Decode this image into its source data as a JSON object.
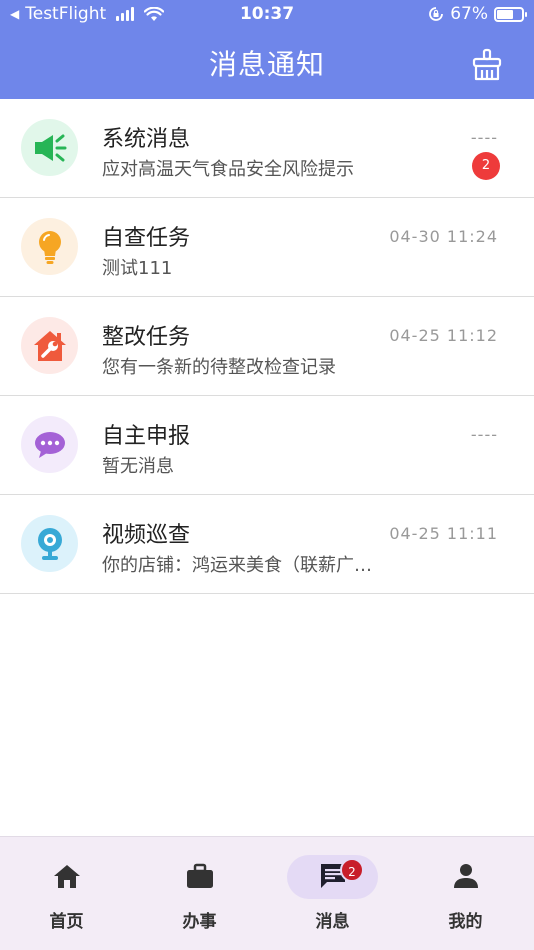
{
  "status_bar": {
    "back_app": "TestFlight",
    "time": "10:37",
    "battery": "67%"
  },
  "header": {
    "title": "消息通知",
    "clean_icon": "broom-icon"
  },
  "colors": {
    "header_bg": "#6f86ea",
    "badge": "#ee3b3b",
    "tab_badge": "#c81e2a",
    "tabbar_bg": "#f3ecf6"
  },
  "messages": [
    {
      "icon": "speaker-icon",
      "title": "系统消息",
      "subtitle": "应对高温天气食品安全风险提示",
      "time": "----",
      "badge": "2"
    },
    {
      "icon": "lightbulb-icon",
      "title": "自查任务",
      "subtitle": "测试111",
      "time": "04-30 11:24",
      "badge": ""
    },
    {
      "icon": "house-wrench-icon",
      "title": "整改任务",
      "subtitle": "您有一条新的待整改检查记录",
      "time": "04-25 11:12",
      "badge": ""
    },
    {
      "icon": "chat-bubble-icon",
      "title": "自主申报",
      "subtitle": "暂无消息",
      "time": "----",
      "badge": ""
    },
    {
      "icon": "webcam-icon",
      "title": "视频巡查",
      "subtitle": "你的店铺：鸿运来美食（联薪广…",
      "time": "04-25 11:11",
      "badge": ""
    }
  ],
  "tabbar": {
    "tabs": [
      {
        "label": "首页",
        "icon": "home-icon",
        "active": false
      },
      {
        "label": "办事",
        "icon": "briefcase-icon",
        "active": false
      },
      {
        "label": "消息",
        "icon": "message-icon",
        "active": true,
        "badge": "2"
      },
      {
        "label": "我的",
        "icon": "person-icon",
        "active": false
      }
    ]
  }
}
